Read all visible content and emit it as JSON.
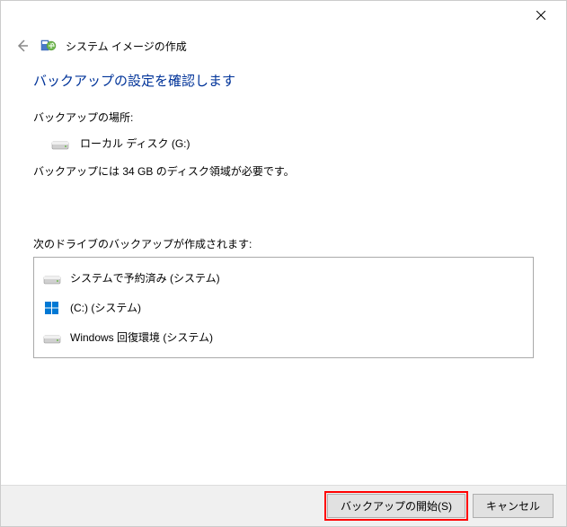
{
  "window": {
    "title": "システム イメージの作成"
  },
  "main": {
    "heading": "バックアップの設定を確認します",
    "location_label": "バックアップの場所:",
    "location_value": "ローカル ディスク (G:)",
    "size_required": "バックアップには 34 GB のディスク領域が必要です。",
    "drives_label": "次のドライブのバックアップが作成されます:",
    "drives": [
      {
        "label": "システムで予約済み (システム)",
        "icon": "disk"
      },
      {
        "label": "(C:) (システム)",
        "icon": "windows"
      },
      {
        "label": "Windows 回復環境 (システム)",
        "icon": "disk"
      }
    ]
  },
  "footer": {
    "start_backup": "バックアップの開始(S)",
    "cancel": "キャンセル"
  }
}
